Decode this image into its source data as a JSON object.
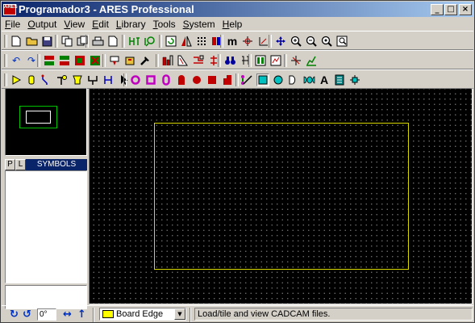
{
  "window": {
    "app_icon_text": "ARES",
    "title": "Programador3 - ARES Professional",
    "controls": {
      "minimize": "_",
      "maximize": "□",
      "close": "×"
    }
  },
  "menu": [
    {
      "underline": "F",
      "rest": "ile"
    },
    {
      "underline": "O",
      "rest": "utput"
    },
    {
      "underline": "V",
      "rest": "iew"
    },
    {
      "underline": "E",
      "rest": "dit"
    },
    {
      "underline": "L",
      "rest": "ibrary"
    },
    {
      "underline": "T",
      "rest": "ools"
    },
    {
      "underline": "S",
      "rest": "ystem"
    },
    {
      "underline": "H",
      "rest": "elp"
    }
  ],
  "toolbar": {
    "zoom_m_label": "m",
    "text_tool_label": "A"
  },
  "left_panel": {
    "p_tab": "P",
    "l_tab": "L",
    "header": "SYMBOLS"
  },
  "statusbar": {
    "rotation_value": "0°",
    "layer": "Board Edge",
    "layer_color": "#ffff00",
    "message": "Load/tile and view CADCAM files."
  },
  "colors": {
    "title_gradient_start": "#0a246a",
    "canvas_bg": "#000000",
    "board_edge": "#d8d800",
    "overview_board": "#00c000"
  }
}
